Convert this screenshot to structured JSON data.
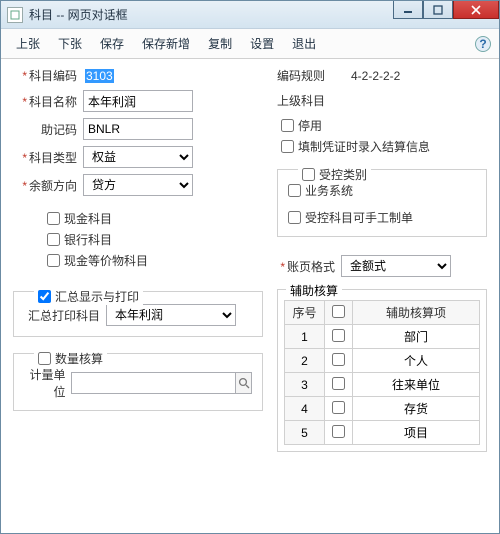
{
  "window": {
    "title": "科目 -- 网页对话框"
  },
  "toolbar": {
    "items": [
      "上张",
      "下张",
      "保存",
      "保存新增",
      "复制",
      "设置",
      "退出"
    ]
  },
  "left": {
    "code_label": "科目编码",
    "code_val": "3103",
    "name_label": "科目名称",
    "name_val": "本年利润",
    "mnemo_label": "助记码",
    "mnemo_val": "BNLR",
    "type_label": "科目类型",
    "type_val": "权益",
    "dir_label": "余额方向",
    "dir_val": "贷方",
    "cash_label": "现金科目",
    "bank_label": "银行科目",
    "equiv_label": "现金等价物科目",
    "grp_summary": "汇总显示与打印",
    "sum_print_label": "汇总打印科目",
    "sum_print_val": "本年利润",
    "grp_qty": "数量核算",
    "unit_label": "计量单位"
  },
  "right": {
    "rule_label": "编码规则",
    "rule_val": "4-2-2-2-2",
    "parent_label": "上级科目",
    "disable_label": "停用",
    "voucher_label": "填制凭证时录入结算信息",
    "grp_ctrl": "受控类别",
    "biz_label": "业务系统",
    "manual_label": "受控科目可手工制单",
    "fmt_label": "账页格式",
    "fmt_val": "金额式",
    "grp_aux": "辅助核算",
    "th_sn": "序号",
    "th_item": "辅助核算项",
    "rows": [
      {
        "sn": "1",
        "item": "部门"
      },
      {
        "sn": "2",
        "item": "个人"
      },
      {
        "sn": "3",
        "item": "往来单位"
      },
      {
        "sn": "4",
        "item": "存货"
      },
      {
        "sn": "5",
        "item": "项目"
      }
    ]
  }
}
